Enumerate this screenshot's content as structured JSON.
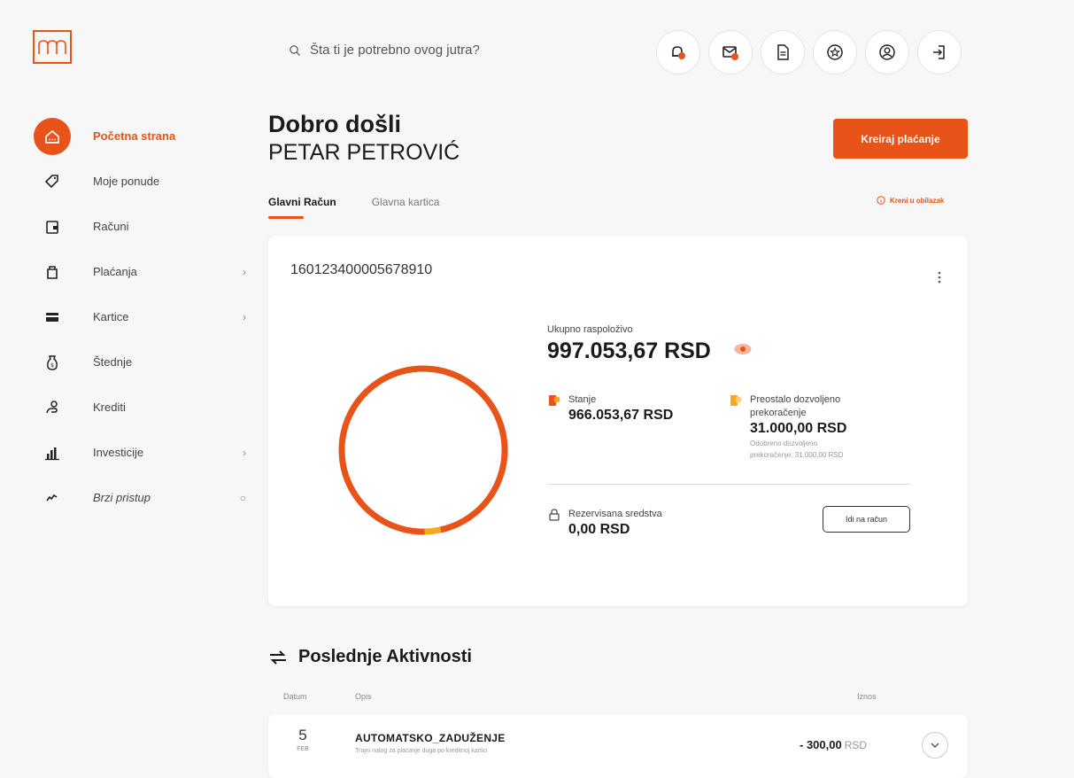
{
  "colors": {
    "accent": "#e8531a",
    "accent_light": "#f5a623",
    "text_dark": "#1a1a1a"
  },
  "logo": {
    "icon": "bank-logo-icon"
  },
  "search": {
    "placeholder": "Šta ti je potrebno ovog jutra?"
  },
  "top_icons": [
    {
      "name": "notifications-icon"
    },
    {
      "name": "messages-icon"
    },
    {
      "name": "documents-icon"
    },
    {
      "name": "favorites-icon"
    },
    {
      "name": "profile-icon"
    },
    {
      "name": "logout-icon"
    }
  ],
  "sidebar": {
    "items": [
      {
        "label": "Početna strana",
        "icon": "home-icon",
        "active": true
      },
      {
        "label": "Moje ponude",
        "icon": "tag-icon"
      },
      {
        "label": "Računi",
        "icon": "wallet-icon"
      },
      {
        "label": "Plaćanja",
        "icon": "payments-icon",
        "chevron": "›"
      },
      {
        "label": "Kartice",
        "icon": "card-icon",
        "chevron": "›"
      },
      {
        "label": "Štednje",
        "icon": "savings-icon"
      },
      {
        "label": "Krediti",
        "icon": "loan-icon"
      },
      {
        "label": "Investicije",
        "icon": "investments-icon",
        "chevron": "›"
      },
      {
        "label": "Brzi pristup",
        "icon": "quick-access-icon",
        "chevron": "○"
      }
    ]
  },
  "greeting": {
    "line1": "Dobro došli",
    "line2": "PETAR PETROVIĆ"
  },
  "create_payment_label": "Kreiraj plaćanje",
  "tabs": [
    {
      "label": "Glavni Račun",
      "active": true
    },
    {
      "label": "Glavna kartica"
    }
  ],
  "shortcut_label": "Kreni u obilazak",
  "account": {
    "number": "160123400005678910",
    "available_label": "Ukupno raspoloživo",
    "available_value": "997.053,67 RSD",
    "balance_label": "Stanje",
    "balance_value": "966.053,67 RSD",
    "overdraft_label_1": "Preostalo dozvoljeno",
    "overdraft_label_2": "prekoračenje",
    "overdraft_value": "31.000,00 RSD",
    "overdraft_note_1": "Odobreno dozvoljeno",
    "overdraft_note_2": "prekoračenje: 31.000,00 RSD",
    "reserved_label": "Rezervisana sredstva",
    "reserved_value": "0,00 RSD",
    "go_to_account_label": "Idi na račun"
  },
  "chart_data": {
    "type": "pie",
    "categories": [
      "Stanje",
      "Preostalo dozvoljeno prekoračenje"
    ],
    "values": [
      966053.67,
      31000.0
    ],
    "colors": [
      "#e8531a",
      "#f5a623"
    ]
  },
  "activities": {
    "title": "Poslednje Aktivnosti",
    "col_date": "Datum",
    "col_desc": "Opis",
    "col_amount": "Iznos",
    "rows": [
      {
        "day": "5",
        "month": "FEB",
        "title": "AUTOMATSKO_ZADUŽENJE",
        "desc": "Trajni nalog za plaćanje duga po kreditnoj kartici",
        "amount": "- 300,00",
        "currency": "RSD"
      }
    ]
  }
}
